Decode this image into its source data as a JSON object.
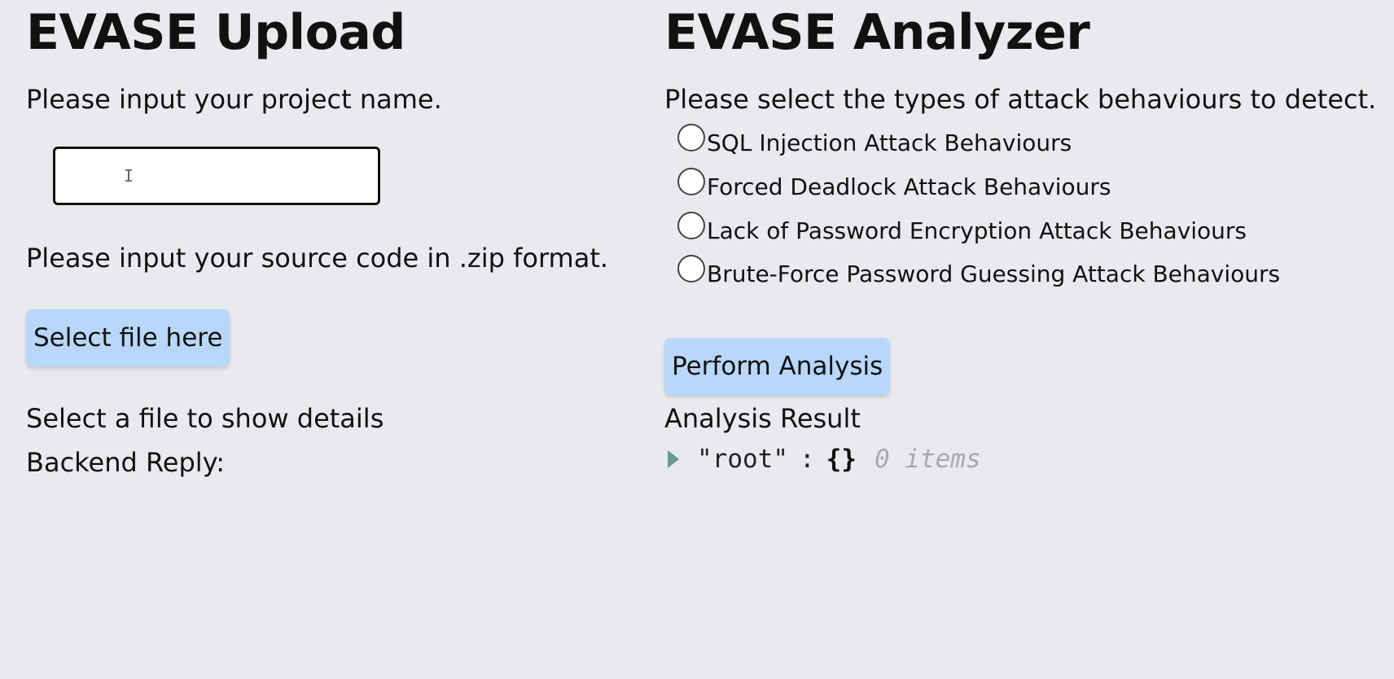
{
  "upload": {
    "title": "EVASE Upload",
    "project_prompt": "Please input your project name.",
    "project_input_value": "",
    "source_prompt": "Please input your source code in .zip format.",
    "select_file_label": "Select file here",
    "file_details": "Select a file to show details",
    "backend_reply_label": "Backend Reply:"
  },
  "analyzer": {
    "title": "EVASE Analyzer",
    "prompt": "Please select the types of attack behaviours to detect.",
    "options": [
      {
        "label": "SQL Injection Attack Behaviours"
      },
      {
        "label": "Forced Deadlock Attack Behaviours"
      },
      {
        "label": "Lack of Password Encryption Attack Behaviours"
      },
      {
        "label": "Brute-Force Password Guessing Attack Behaviours"
      }
    ],
    "perform_label": "Perform Analysis",
    "result_label": "Analysis Result",
    "result_tree": {
      "key": "\"root\"",
      "separator": ":",
      "value": "{}",
      "count": "0 items"
    }
  },
  "icons": {
    "expand": "caret-right-icon",
    "cursor": "text-cursor-icon"
  },
  "colors": {
    "background": "#e9eaee",
    "button": "#b8d7fb",
    "caret": "#6a9a8e",
    "muted": "#a7a9ad"
  }
}
